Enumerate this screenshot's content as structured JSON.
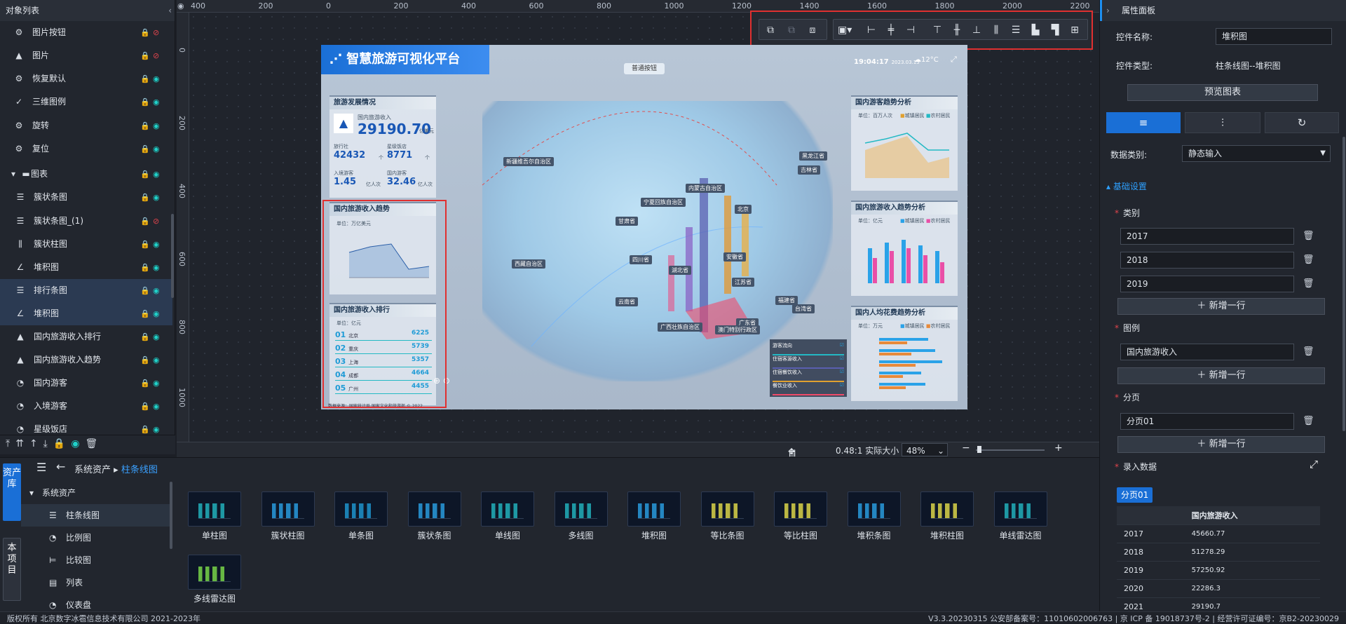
{
  "left_panel": {
    "title": "对象列表",
    "collapse_icon": "chevron-left-icon",
    "items": [
      {
        "label": "图片按钮",
        "icon": "gear-icon",
        "visible": false
      },
      {
        "label": "图片",
        "icon": "image-icon",
        "visible": false
      },
      {
        "label": "恢复默认",
        "icon": "gear-icon",
        "visible": true
      },
      {
        "label": "三维图例",
        "icon": "check-icon",
        "visible": true
      },
      {
        "label": "旋转",
        "icon": "gear-icon",
        "visible": true
      },
      {
        "label": "复位",
        "icon": "gear-icon",
        "visible": true
      },
      {
        "label": "图表",
        "icon": "folder-icon",
        "visible": true
      },
      {
        "label": "簇状条图",
        "icon": "bar-icon",
        "visible": true
      },
      {
        "label": "簇状条图_(1)",
        "icon": "bar-icon",
        "visible": false
      },
      {
        "label": "簇状柱图",
        "icon": "column-icon",
        "visible": true
      },
      {
        "label": "堆积图",
        "icon": "line-icon",
        "visible": true
      },
      {
        "label": "排行条图",
        "icon": "bar-icon",
        "visible": true
      },
      {
        "label": "堆积图",
        "icon": "line-icon",
        "visible": true
      },
      {
        "label": "国内旅游收入排行",
        "icon": "image-icon",
        "visible": true
      },
      {
        "label": "国内旅游收入趋势",
        "icon": "image-icon",
        "visible": true
      },
      {
        "label": "国内游客",
        "icon": "gauge-icon",
        "visible": true
      },
      {
        "label": "入境游客",
        "icon": "gauge-icon",
        "visible": true
      },
      {
        "label": "星级饭店",
        "icon": "gauge-icon",
        "visible": true
      }
    ]
  },
  "rulers": {
    "h": [
      "400",
      "200",
      "0",
      "200",
      "400",
      "600",
      "800",
      "1000",
      "1200",
      "1400",
      "1600",
      "1800",
      "2000",
      "2200"
    ],
    "v": [
      "0",
      "200",
      "400",
      "600",
      "800",
      "1000"
    ]
  },
  "dashboard": {
    "title": "智慧旅游可视化平台",
    "button": "普通按钮",
    "time": "19:04:17",
    "date": "2023.03.15",
    "temp": "12°C",
    "dev": {
      "title": "旅游发展情况",
      "income_label": "国内旅游收入",
      "income": "29190.70",
      "income_unit": "亿美元",
      "s1_label": "旅行社",
      "s1": "42432",
      "s1_unit": "个",
      "s2_label": "星级饭店",
      "s2": "8771",
      "s2_unit": "个",
      "s3_label": "入境游客",
      "s3": "1.45",
      "s3_unit": "亿人次",
      "s4_label": "国内游客",
      "s4": "32.46",
      "s4_unit": "亿人次"
    },
    "trend": {
      "title": "国内旅游收入趋势",
      "unit": "单位：万亿美元"
    },
    "rank": {
      "title": "国内旅游收入排行",
      "unit": "单位：亿元",
      "rows": [
        {
          "no": "01",
          "name": "北京",
          "val": "6225"
        },
        {
          "no": "02",
          "name": "重庆",
          "val": "5739"
        },
        {
          "no": "03",
          "name": "上海",
          "val": "5357"
        },
        {
          "no": "04",
          "name": "成都",
          "val": "4664"
        },
        {
          "no": "05",
          "name": "广州",
          "val": "4455"
        }
      ]
    },
    "r1": {
      "title": "国内游客趋势分析",
      "unit": "单位：百万人次",
      "legend1": "城镇居民",
      "legend2": "农村居民"
    },
    "r2": {
      "title": "国内旅游收入趋势分析",
      "unit": "单位：亿元",
      "legend1": "城镇居民",
      "legend2": "农村居民"
    },
    "r3": {
      "title": "国内人均花费趋势分析",
      "unit": "单位：万元",
      "legend1": "城镇居民",
      "legend2": "农村居民"
    },
    "map_labels": [
      "新疆维吾尔自治区",
      "内蒙古自治区",
      "宁夏回族自治区",
      "黑龙江省",
      "吉林省",
      "北京",
      "甘肃省",
      "西藏自治区",
      "四川省",
      "湖北省",
      "江苏省",
      "安徽省",
      "云南省",
      "广东省",
      "广西壮族自治区",
      "台湾省",
      "澳门特别行政区",
      "福建省"
    ],
    "legend_box": [
      "游客流向",
      "住宿客源收入",
      "住宿餐饮收入",
      "餐饮业收入"
    ],
    "footer": "数据来源：国家统计局 国家文化和旅游部 © 2022"
  },
  "zoom": {
    "fit": "自适应",
    "ratio": "0.48:1 实际大小",
    "value": "48%"
  },
  "assets": {
    "side_tab1": "资产库",
    "side_tab2": "本项目",
    "breadcrumb_root": "系统资产",
    "breadcrumb_current": "柱条线图",
    "tree": [
      "系统资产",
      "柱条线图",
      "比例图",
      "比较图",
      "列表",
      "仪表盘"
    ],
    "thumbs": [
      "单柱图",
      "簇状柱图",
      "单条图",
      "簇状条图",
      "单线图",
      "多线图",
      "堆积图",
      "等比条图",
      "等比柱图",
      "堆积条图",
      "堆积柱图",
      "单线雷达图",
      "多线雷达图"
    ]
  },
  "right_panel": {
    "title": "属性面板",
    "name_label": "控件名称:",
    "name_value": "堆积图",
    "type_label": "控件类型:",
    "type_value": "柱条线图--堆积图",
    "preview": "预览图表",
    "data_type_label": "数据类别:",
    "data_type_value": "静态输入",
    "section": "基础设置",
    "category_label": "类别",
    "categories": [
      "2017",
      "2018",
      "2019"
    ],
    "add_row": "新增一行",
    "legend_label": "图例",
    "legend_value": "国内旅游收入",
    "page_label": "分页",
    "page_value": "分页01",
    "entry_label": "录入数据",
    "page_tab": "分页01",
    "table": {
      "col": "国内旅游收入",
      "rows": [
        [
          "2017",
          "45660.77"
        ],
        [
          "2018",
          "51278.29"
        ],
        [
          "2019",
          "57250.92"
        ],
        [
          "2020",
          "22286.3"
        ],
        [
          "2021",
          "29190.7"
        ]
      ]
    }
  },
  "footer": {
    "left": "版权所有 北京数字冰雹信息技术有限公司 2021-2023年",
    "right": "V3.3.20230315 公安部备案号：11010602006763 | 京 ICP 备 19018737号-2 | 经营许可证编号：京B2-20230029"
  }
}
